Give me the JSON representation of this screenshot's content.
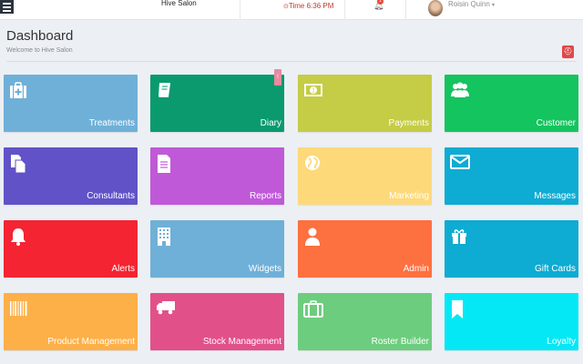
{
  "topbar": {
    "salon_name": "Hive Salon",
    "time_label": "Time",
    "time_value": "6:36 PM",
    "notification_count": "1",
    "user_name": "Roisin Quinn",
    "user_caret": "▾"
  },
  "header": {
    "title": "Dashboard",
    "subtitle": "Welcome to Hive Salon",
    "help_glyph": "⛑"
  },
  "tiles": [
    {
      "label": "Treatments",
      "color": "#6fb0d8",
      "icon": "medical-kit-icon"
    },
    {
      "label": "Diary",
      "color": "#0a9a6e",
      "icon": "book-icon",
      "badge": "!"
    },
    {
      "label": "Payments",
      "color": "#c5cc45",
      "icon": "money-icon"
    },
    {
      "label": "Customer",
      "color": "#14c45f",
      "icon": "users-icon"
    },
    {
      "label": "Consultants",
      "color": "#6152c8",
      "icon": "documents-icon"
    },
    {
      "label": "Reports",
      "color": "#c059d8",
      "icon": "file-text-icon"
    },
    {
      "label": "Marketing",
      "color": "#fdd97a",
      "icon": "globe-icon"
    },
    {
      "label": "Messages",
      "color": "#0eabd3",
      "icon": "envelope-icon"
    },
    {
      "label": "Alerts",
      "color": "#f42432",
      "icon": "bell-icon"
    },
    {
      "label": "Widgets",
      "color": "#6fb0d8",
      "icon": "building-icon"
    },
    {
      "label": "Admin",
      "color": "#fd7040",
      "icon": "user-icon"
    },
    {
      "label": "Gift Cards",
      "color": "#0eabd3",
      "icon": "gift-icon"
    },
    {
      "label": "Product Management",
      "color": "#fdb048",
      "icon": "barcode-icon"
    },
    {
      "label": "Stock Management",
      "color": "#e2508a",
      "icon": "truck-icon"
    },
    {
      "label": "Roster Builder",
      "color": "#6dcd7e",
      "icon": "briefcase-icon"
    },
    {
      "label": "Loyalty",
      "color": "#04e8f6",
      "icon": "bookmark-icon"
    }
  ]
}
